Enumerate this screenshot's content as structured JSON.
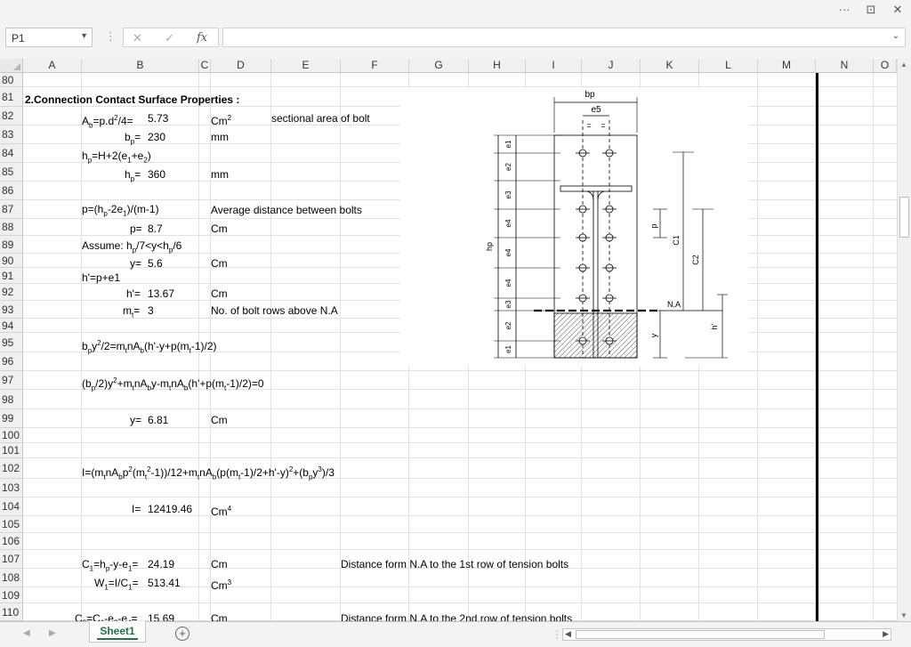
{
  "titlebar": {
    "more": "···",
    "restore": "⊡",
    "close": "✕"
  },
  "formula_bar": {
    "name_box": "P1",
    "cancel": "✕",
    "enter": "✓",
    "fx": "fx",
    "formula": ""
  },
  "columns": [
    "A",
    "B",
    "C",
    "D",
    "E",
    "F",
    "G",
    "H",
    "I",
    "J",
    "K",
    "L",
    "M",
    "N",
    "O"
  ],
  "rows": [
    "80",
    "81",
    "82",
    "83",
    "84",
    "85",
    "86",
    "87",
    "88",
    "89",
    "90",
    "91",
    "92",
    "93",
    "94",
    "95",
    "96",
    "97",
    "98",
    "99",
    "100",
    "101",
    "102",
    "103",
    "104",
    "105",
    "106",
    "107",
    "108",
    "109",
    "110"
  ],
  "cells": {
    "title": "2.Connection Contact Surface Properties :",
    "ab_val": "5.73",
    "ab_desc": "sectional area of bolt",
    "bp_val": "230",
    "unit_mm": "mm",
    "hp_val": "360",
    "p_desc": "Average distance between bolts",
    "p_val": "8.7",
    "unit_cm": "Cm",
    "y_val": "5.6",
    "h1_val": "13.67",
    "mt_val": "3",
    "mt_desc": "No. of bolt rows above N.A",
    "y2_val": "6.81",
    "I_label": "I=",
    "I_val": "12419.46",
    "c1_val": "24.19",
    "c1_desc": "Distance form N.A to the 1st row of tension bolts",
    "w1_val": "513.41",
    "c2_val": "15.69",
    "c2_desc": "Distance form N.A to the 2nd row of tension bolts"
  },
  "diagram": {
    "bp": "bp",
    "e5": "e5",
    "hp": "hp",
    "na": "N.A",
    "c1": "C1",
    "c2": "C2",
    "p": "p",
    "y": "y",
    "h1": "h'",
    "left_labels": [
      "e1",
      "e2",
      "e3",
      "e4",
      "e4",
      "e4",
      "e3",
      "e2",
      "e1"
    ]
  },
  "sheet_tab": "Sheet1",
  "colors": {
    "accent": "#217346",
    "grid": "#e1e1e1"
  }
}
